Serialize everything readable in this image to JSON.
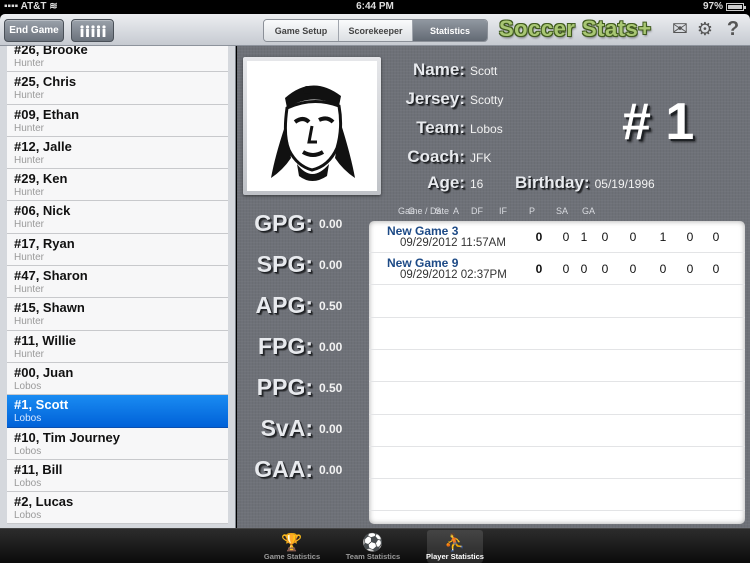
{
  "status_bar": {
    "carrier": "AT&T",
    "time": "6:44 PM",
    "battery": "97%"
  },
  "toolbar": {
    "end_game_label": "End Game",
    "roster_icon": "team-roster-icon",
    "segments": [
      {
        "label": "Game Setup",
        "active": false
      },
      {
        "label": "Scorekeeper",
        "active": false
      },
      {
        "label": "Statistics",
        "active": true
      }
    ],
    "app_title": "Soccer Stats+",
    "icons": [
      "mail-icon",
      "gear-icon",
      "help-icon"
    ],
    "mail_glyph": "✉",
    "gear_glyph": "⚙",
    "help_glyph": "?"
  },
  "players": [
    {
      "name": "#26, Brooke",
      "team": "Hunter"
    },
    {
      "name": "#25, Chris",
      "team": "Hunter"
    },
    {
      "name": "#09, Ethan",
      "team": "Hunter"
    },
    {
      "name": "#12, Jalle",
      "team": "Hunter"
    },
    {
      "name": "#29, Ken",
      "team": "Hunter"
    },
    {
      "name": "#06, Nick",
      "team": "Hunter"
    },
    {
      "name": "#17, Ryan",
      "team": "Hunter"
    },
    {
      "name": "#47, Sharon",
      "team": "Hunter"
    },
    {
      "name": "#15, Shawn",
      "team": "Hunter"
    },
    {
      "name": "#11, Willie",
      "team": "Hunter"
    },
    {
      "name": "#00, Juan",
      "team": "Lobos"
    },
    {
      "name": "#1, Scott",
      "team": "Lobos",
      "selected": true
    },
    {
      "name": "#10, Tim Journey",
      "team": "Lobos"
    },
    {
      "name": "#11, Bill",
      "team": "Lobos"
    },
    {
      "name": "#2, Lucas",
      "team": "Lobos"
    }
  ],
  "player": {
    "name_label": "Name:",
    "name": "Scott",
    "jersey_label": "Jersey:",
    "jersey": "Scotty",
    "team_label": "Team:",
    "team": "Lobos",
    "coach_label": "Coach:",
    "coach": "JFK",
    "age_label": "Age:",
    "age": "16",
    "birthday_label": "Birthday:",
    "birthday": "05/19/1996",
    "number_display": "# 1"
  },
  "averages": [
    {
      "label": "GPG:",
      "value": "0.00"
    },
    {
      "label": "SPG:",
      "value": "0.00"
    },
    {
      "label": "APG:",
      "value": "0.50"
    },
    {
      "label": "FPG:",
      "value": "0.00"
    },
    {
      "label": "PPG:",
      "value": "0.50"
    },
    {
      "label": "SvA:",
      "value": "0.00"
    },
    {
      "label": "GAA:",
      "value": "0.00"
    }
  ],
  "games_table": {
    "headers": [
      "Game / Date",
      "G",
      "S",
      "A",
      "DF",
      "IF",
      "P",
      "SA",
      "GA"
    ],
    "rows": [
      {
        "game": "New Game 3",
        "date": "09/29/2012 11:57AM",
        "stats": [
          "0",
          "0",
          "1",
          "0",
          "0",
          "1",
          "0",
          "0"
        ]
      },
      {
        "game": "New Game 9",
        "date": "09/29/2012 02:37PM",
        "stats": [
          "0",
          "0",
          "0",
          "0",
          "0",
          "0",
          "0",
          "0"
        ]
      }
    ]
  },
  "tab_bar": [
    {
      "label": "Game Statistics",
      "icon": "trophy-icon",
      "glyph": "🏆",
      "active": false
    },
    {
      "label": "Team Statistics",
      "icon": "soccer-ball-icon",
      "glyph": "⚽",
      "active": false
    },
    {
      "label": "Player Statistics",
      "icon": "player-kick-icon",
      "glyph": "⛹",
      "active": true
    }
  ]
}
